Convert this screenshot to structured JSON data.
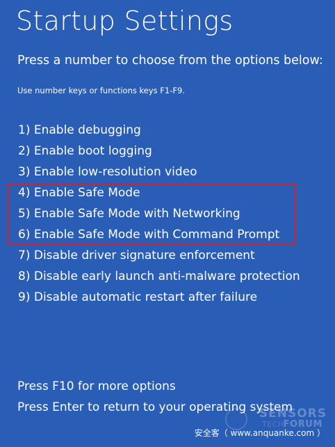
{
  "screen": {
    "title": "Startup Settings",
    "subtitle": "Press a number to choose from the options below:",
    "hint": "Use number keys or functions keys F1-F9."
  },
  "options": [
    {
      "label": "1) Enable debugging"
    },
    {
      "label": "2) Enable boot logging"
    },
    {
      "label": "3) Enable low-resolution video"
    },
    {
      "label": "4) Enable Safe Mode"
    },
    {
      "label": "5) Enable Safe Mode with Networking"
    },
    {
      "label": "6) Enable Safe Mode with Command Prompt"
    },
    {
      "label": "7) Disable driver signature enforcement"
    },
    {
      "label": "8) Disable early launch anti-malware protection"
    },
    {
      "label": "9) Disable automatic restart after failure"
    }
  ],
  "footer": {
    "f10": "Press F10 for more options",
    "enter": "Press Enter to return to your operating system"
  },
  "watermark": {
    "url": "安全客（ www.anquanke.com ）",
    "logo_text_top": "SENSORS",
    "logo_text_tech": "TECH",
    "logo_text_bottom": "FORUM"
  },
  "colors": {
    "background": "#2a5db6",
    "text": "#ffffff",
    "highlight_border": "#d4202a"
  }
}
